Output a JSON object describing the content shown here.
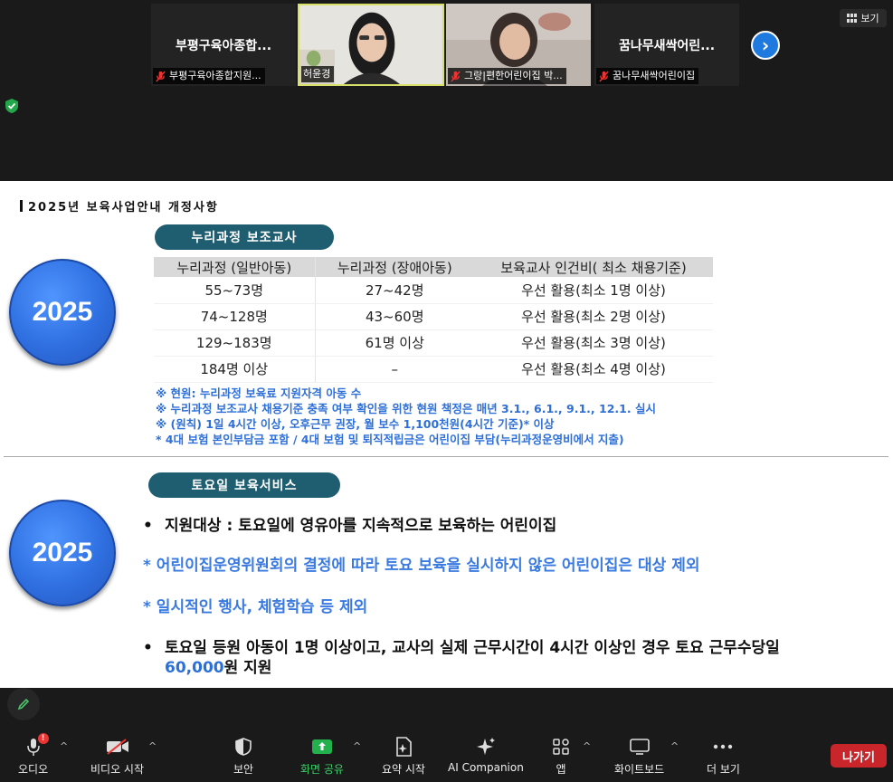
{
  "participants": [
    {
      "display": "부평구육아종합...",
      "caption": "부평구육아종합지원..."
    },
    {
      "caption": "허윤경"
    },
    {
      "caption": "그랑|편한어린이집 박..."
    },
    {
      "display": "꿈나무새싹어린...",
      "caption": "꿈나무새싹어린이집"
    }
  ],
  "view_label": "보기",
  "slide": {
    "title": "2025년 보육사업안내 개정사항",
    "section1": {
      "year": "2025",
      "pill": "누리과정 보조교사",
      "headers": [
        "누리과정 (일반아동)",
        "누리과정 (장애아동)",
        "보육교사 인건비( 최소 채용기준)"
      ],
      "rows": [
        [
          "55~73명",
          "27~42명",
          "우선 활용(최소 1명 이상)"
        ],
        [
          "74~128명",
          "43~60명",
          "우선 활용(최소 2명 이상)"
        ],
        [
          "129~183명",
          "61명 이상",
          "우선 활용(최소 3명 이상)"
        ],
        [
          "184명 이상",
          "–",
          "우선 활용(최소 4명 이상)"
        ]
      ],
      "notes": [
        "※ 현원: 누리과정 보육료 지원자격 아동 수",
        "※ 누리과정 보조교사 채용기준 충족 여부 확인을 위한 현원 책정은 매년 3.1., 6.1., 9.1., 12.1. 실시",
        "※ (원칙) 1일 4시간 이상, 오후근무 권장, 월 보수 1,100천원(4시간 기준)* 이상",
        "* 4대 보험 본인부담금 포함 / 4대 보험 및 퇴직적립금은 어린이집 부담(누리과정운영비에서 지출)"
      ]
    },
    "section2": {
      "year": "2025",
      "pill": "토요일 보육서비스",
      "bullet1": "지원대상 : 토요일에 영유아를 지속적으로 보육하는 어린이집",
      "star1": "* 어린이집운영위원회의 결정에 따라 토요 보육을 실시하지 않은 어린이집은 대상 제외",
      "star2": "* 일시적인 행사, 체험학습 등 제외",
      "bullet2": "토요일 등원 아동이 1명 이상이고, 교사의 실제 근무시간이 4시간 이상인 경우 토요 근무수당일",
      "bullet2b_amount": "60,000",
      "bullet2b_rest": "원 지원"
    }
  },
  "toolbar": {
    "audio": "오디오",
    "video": "비디오 시작",
    "security": "보안",
    "share": "화면 공유",
    "summary": "요약 시작",
    "ai": "AI Companion",
    "apps": "앱",
    "whiteboard": "화이트보드",
    "more": "더 보기",
    "leave": "나가기",
    "audio_badge": "!"
  }
}
